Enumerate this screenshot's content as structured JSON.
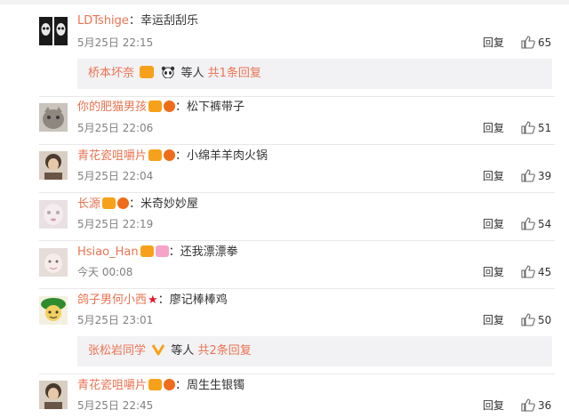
{
  "comments": [
    {
      "user": "LDTshige",
      "text": "幸运刮刮乐",
      "time": "5月25日 22:15",
      "reply": "回复",
      "likes": "65"
    },
    {
      "user": "你的肥猫男孩",
      "text": "松下裤带子",
      "time": "5月25日 22:06",
      "reply": "回复",
      "likes": "51"
    },
    {
      "user": "青花瓷咀嚼片",
      "text": "小绵羊羊肉火锅",
      "time": "5月25日 22:04",
      "reply": "回复",
      "likes": "39"
    },
    {
      "user": "长源",
      "text": "米奇妙妙屋",
      "time": "5月25日 22:19",
      "reply": "回复",
      "likes": "54"
    },
    {
      "user": "Hsiao_Han",
      "text": "还我漂漂拳",
      "time": "今天 00:08",
      "reply": "回复",
      "likes": "45"
    },
    {
      "user": "鸽子男何小西",
      "text": "廖记棒棒鸡",
      "time": "5月25日 23:01",
      "reply": "回复",
      "likes": "50"
    },
    {
      "user": "青花瓷咀嚼片",
      "text": "周生生银镯",
      "time": "5月25日 22:45",
      "reply": "回复",
      "likes": "36"
    }
  ],
  "subreplies": [
    {
      "user": "桥本坏奈",
      "etc": "等人",
      "more": "共1条回复"
    },
    {
      "user": "张松岩同学",
      "etc": "等人",
      "more": "共2条回复"
    }
  ],
  "colors": {
    "username": "#eb7350",
    "text": "#333333",
    "time": "#808080",
    "subbox": "#f2f2f5"
  }
}
